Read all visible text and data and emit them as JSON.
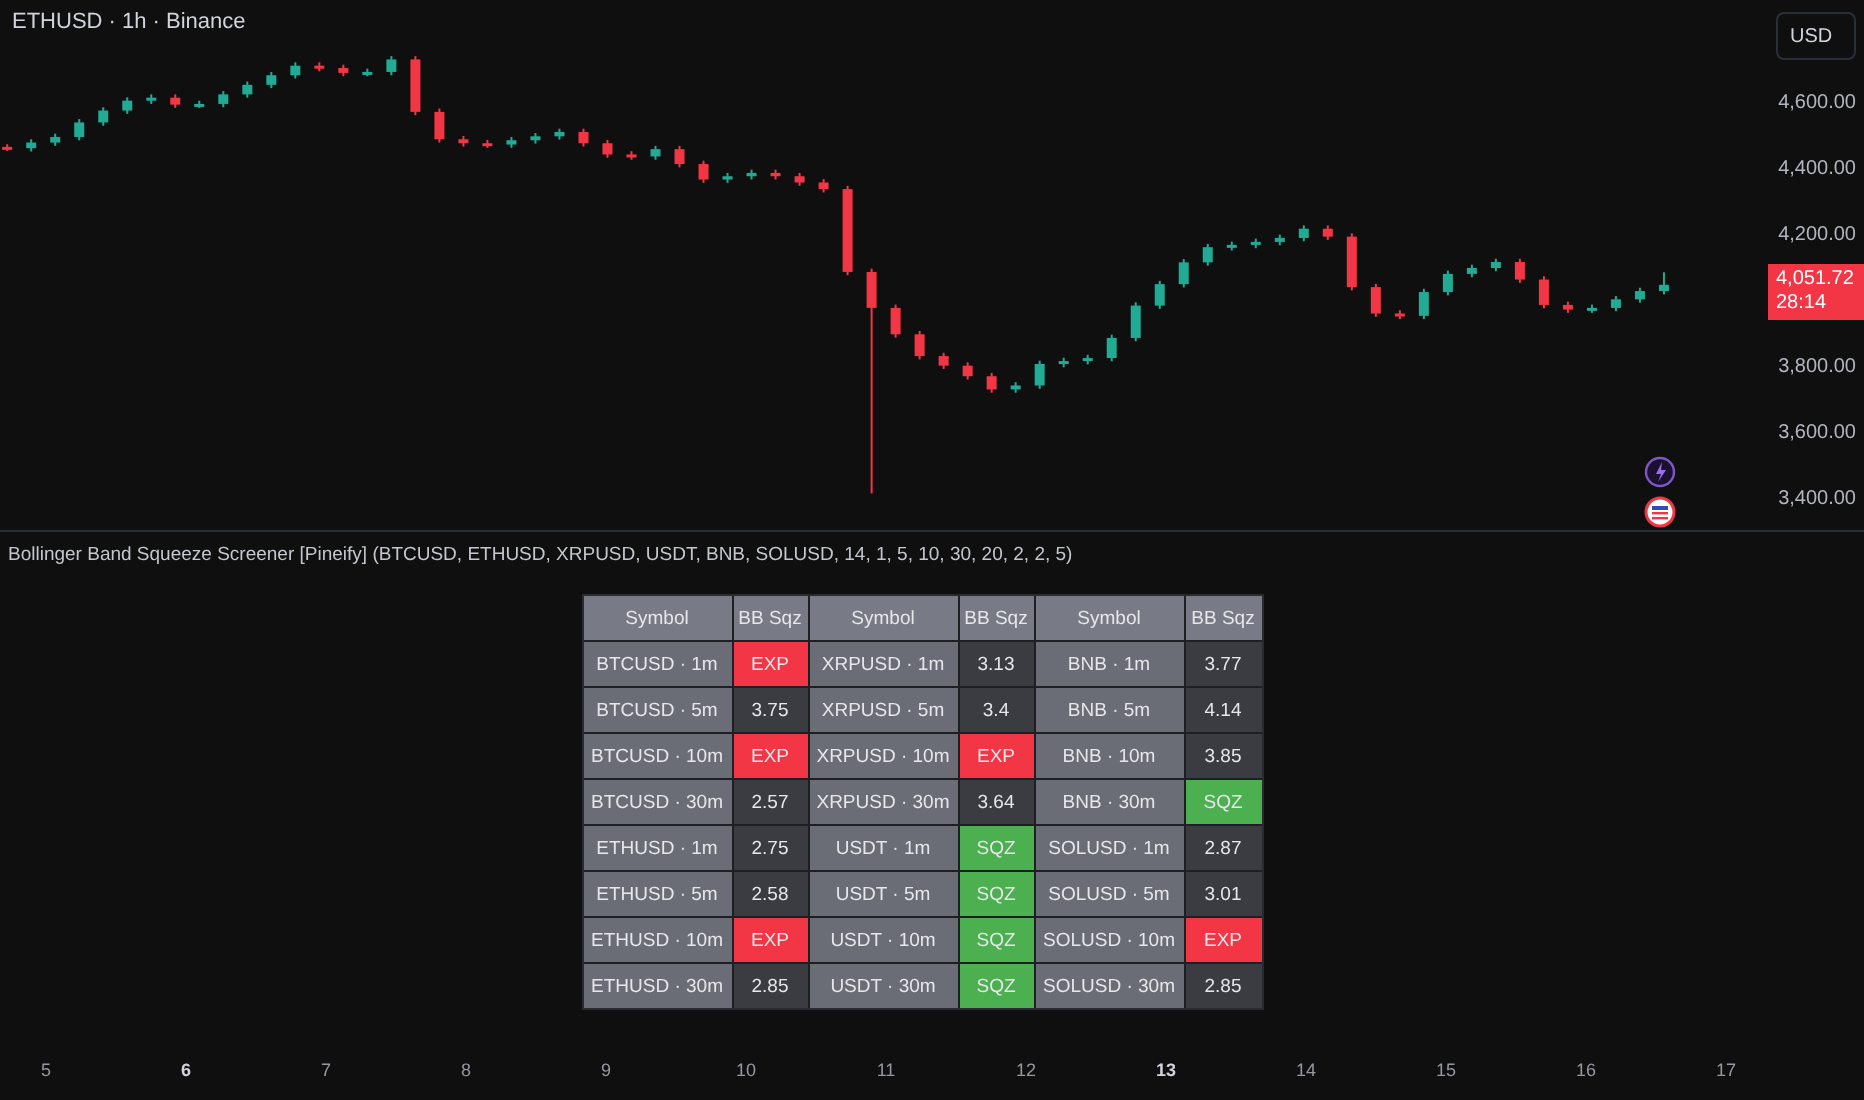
{
  "chart": {
    "title": "ETHUSD · 1h · Binance",
    "chart_data": {
      "type": "candlestick",
      "categories": [
        null,
        null,
        null,
        null,
        null,
        null,
        null,
        null,
        null,
        null,
        null,
        null,
        null,
        null,
        null,
        null,
        null,
        null,
        null,
        null,
        null,
        null,
        null,
        null,
        null,
        null,
        null,
        null,
        null,
        null,
        null,
        null,
        null,
        null,
        null,
        null,
        null,
        null,
        null,
        null,
        null,
        null,
        null,
        null,
        null,
        null,
        null,
        null,
        null,
        null,
        null,
        null,
        null,
        null,
        null,
        null,
        null,
        null,
        null,
        null,
        null,
        null,
        null,
        null,
        null,
        null,
        null,
        null,
        null,
        null
      ],
      "ylim": [
        3400,
        4600
      ],
      "yticks": [
        {
          "value": 4600,
          "label": "4,600.00"
        },
        {
          "value": 4400,
          "label": "4,400.00"
        },
        {
          "value": 4200,
          "label": "4,200.00"
        },
        {
          "value": 3800,
          "label": "3,800.00"
        },
        {
          "value": 3600,
          "label": "3,600.00"
        },
        {
          "value": 3400,
          "label": "3,400.00"
        }
      ],
      "ohlc": [
        [
          4470,
          4478,
          4458,
          4466
        ],
        [
          4466,
          4493,
          4456,
          4483
        ],
        [
          4483,
          4510,
          4473,
          4500
        ],
        [
          4500,
          4554,
          4490,
          4544
        ],
        [
          4544,
          4590,
          4534,
          4580
        ],
        [
          4580,
          4620,
          4570,
          4610
        ],
        [
          4610,
          4629,
          4600,
          4619
        ],
        [
          4619,
          4629,
          4588,
          4598
        ],
        [
          4598,
          4610,
          4588,
          4600
        ],
        [
          4600,
          4639,
          4590,
          4629
        ],
        [
          4629,
          4668,
          4619,
          4658
        ],
        [
          4658,
          4697,
          4648,
          4687
        ],
        [
          4687,
          4726,
          4677,
          4716
        ],
        [
          4716,
          4726,
          4699,
          4709
        ],
        [
          4709,
          4719,
          4684,
          4694
        ],
        [
          4694,
          4707,
          4684,
          4697
        ],
        [
          4697,
          4745,
          4687,
          4735
        ],
        [
          4735,
          4745,
          4566,
          4576
        ],
        [
          4576,
          4586,
          4483,
          4493
        ],
        [
          4493,
          4503,
          4471,
          4481
        ],
        [
          4481,
          4491,
          4467,
          4477
        ],
        [
          4477,
          4500,
          4467,
          4490
        ],
        [
          4490,
          4512,
          4480,
          4502
        ],
        [
          4502,
          4525,
          4492,
          4515
        ],
        [
          4515,
          4525,
          4471,
          4481
        ],
        [
          4481,
          4491,
          4437,
          4447
        ],
        [
          4447,
          4457,
          4431,
          4441
        ],
        [
          4441,
          4473,
          4431,
          4463
        ],
        [
          4463,
          4473,
          4408,
          4418
        ],
        [
          4418,
          4428,
          4361,
          4371
        ],
        [
          4371,
          4391,
          4361,
          4381
        ],
        [
          4381,
          4401,
          4371,
          4391
        ],
        [
          4391,
          4401,
          4371,
          4381
        ],
        [
          4381,
          4391,
          4352,
          4362
        ],
        [
          4362,
          4372,
          4332,
          4342
        ],
        [
          4342,
          4352,
          4081,
          4091
        ],
        [
          4091,
          4101,
          3420,
          3982
        ],
        [
          3982,
          3992,
          3892,
          3902
        ],
        [
          3902,
          3912,
          3826,
          3836
        ],
        [
          3836,
          3846,
          3797,
          3807
        ],
        [
          3807,
          3817,
          3765,
          3775
        ],
        [
          3775,
          3785,
          3725,
          3735
        ],
        [
          3735,
          3757,
          3725,
          3747
        ],
        [
          3747,
          3822,
          3737,
          3812
        ],
        [
          3812,
          3831,
          3802,
          3821
        ],
        [
          3821,
          3840,
          3811,
          3830
        ],
        [
          3830,
          3901,
          3820,
          3891
        ],
        [
          3891,
          3999,
          3881,
          3989
        ],
        [
          3989,
          4064,
          3979,
          4054
        ],
        [
          4054,
          4130,
          4044,
          4120
        ],
        [
          4120,
          4176,
          4110,
          4166
        ],
        [
          4166,
          4183,
          4156,
          4173
        ],
        [
          4173,
          4192,
          4163,
          4182
        ],
        [
          4182,
          4204,
          4172,
          4194
        ],
        [
          4194,
          4232,
          4184,
          4222
        ],
        [
          4222,
          4232,
          4188,
          4198
        ],
        [
          4198,
          4208,
          4035,
          4045
        ],
        [
          4045,
          4055,
          3955,
          3965
        ],
        [
          3965,
          3975,
          3948,
          3958
        ],
        [
          3958,
          4040,
          3948,
          4030
        ],
        [
          4030,
          4095,
          4020,
          4085
        ],
        [
          4085,
          4113,
          4075,
          4103
        ],
        [
          4103,
          4131,
          4093,
          4121
        ],
        [
          4121,
          4131,
          4058,
          4068
        ],
        [
          4068,
          4078,
          3981,
          3991
        ],
        [
          3991,
          4001,
          3967,
          3977
        ],
        [
          3977,
          3992,
          3967,
          3982
        ],
        [
          3982,
          4018,
          3972,
          4008
        ],
        [
          4008,
          4043,
          3998,
          4033
        ],
        [
          4033,
          4090,
          4023,
          4052
        ]
      ]
    }
  },
  "currency_button": "USD",
  "price_tag": {
    "last_price": "4,051.72",
    "countdown": "28:14"
  },
  "indicator": {
    "title": "Bollinger Band Squeeze Screener [Pineify] (BTCUSD, ETHUSD, XRPUSD, USDT, BNB, SOLUSD, 14, 1, 5, 10, 30, 20, 2, 2, 5)",
    "columns": [
      "Symbol",
      "BB Sqz",
      "Symbol",
      "BB Sqz",
      "Symbol",
      "BB Sqz"
    ],
    "rows": [
      [
        {
          "text": "BTCUSD · 1m",
          "kind": "symbol"
        },
        {
          "text": "EXP",
          "kind": "exp"
        },
        {
          "text": "XRPUSD · 1m",
          "kind": "symbol"
        },
        {
          "text": "3.13",
          "kind": "value"
        },
        {
          "text": "BNB · 1m",
          "kind": "symbol"
        },
        {
          "text": "3.77",
          "kind": "value"
        }
      ],
      [
        {
          "text": "BTCUSD · 5m",
          "kind": "symbol"
        },
        {
          "text": "3.75",
          "kind": "value"
        },
        {
          "text": "XRPUSD · 5m",
          "kind": "symbol"
        },
        {
          "text": "3.4",
          "kind": "value"
        },
        {
          "text": "BNB · 5m",
          "kind": "symbol"
        },
        {
          "text": "4.14",
          "kind": "value"
        }
      ],
      [
        {
          "text": "BTCUSD · 10m",
          "kind": "symbol"
        },
        {
          "text": "EXP",
          "kind": "exp"
        },
        {
          "text": "XRPUSD · 10m",
          "kind": "symbol"
        },
        {
          "text": "EXP",
          "kind": "exp"
        },
        {
          "text": "BNB · 10m",
          "kind": "symbol"
        },
        {
          "text": "3.85",
          "kind": "value"
        }
      ],
      [
        {
          "text": "BTCUSD · 30m",
          "kind": "symbol"
        },
        {
          "text": "2.57",
          "kind": "value"
        },
        {
          "text": "XRPUSD · 30m",
          "kind": "symbol"
        },
        {
          "text": "3.64",
          "kind": "value"
        },
        {
          "text": "BNB · 30m",
          "kind": "symbol"
        },
        {
          "text": "SQZ",
          "kind": "sqz"
        }
      ],
      [
        {
          "text": "ETHUSD · 1m",
          "kind": "symbol"
        },
        {
          "text": "2.75",
          "kind": "value"
        },
        {
          "text": "USDT · 1m",
          "kind": "symbol"
        },
        {
          "text": "SQZ",
          "kind": "sqz"
        },
        {
          "text": "SOLUSD · 1m",
          "kind": "symbol"
        },
        {
          "text": "2.87",
          "kind": "value"
        }
      ],
      [
        {
          "text": "ETHUSD · 5m",
          "kind": "symbol"
        },
        {
          "text": "2.58",
          "kind": "value"
        },
        {
          "text": "USDT · 5m",
          "kind": "symbol"
        },
        {
          "text": "SQZ",
          "kind": "sqz"
        },
        {
          "text": "SOLUSD · 5m",
          "kind": "symbol"
        },
        {
          "text": "3.01",
          "kind": "value"
        }
      ],
      [
        {
          "text": "ETHUSD · 10m",
          "kind": "symbol"
        },
        {
          "text": "EXP",
          "kind": "exp"
        },
        {
          "text": "USDT · 10m",
          "kind": "symbol"
        },
        {
          "text": "SQZ",
          "kind": "sqz"
        },
        {
          "text": "SOLUSD · 10m",
          "kind": "symbol"
        },
        {
          "text": "EXP",
          "kind": "exp"
        }
      ],
      [
        {
          "text": "ETHUSD · 30m",
          "kind": "symbol"
        },
        {
          "text": "2.85",
          "kind": "value"
        },
        {
          "text": "USDT · 30m",
          "kind": "symbol"
        },
        {
          "text": "SQZ",
          "kind": "sqz"
        },
        {
          "text": "SOLUSD · 30m",
          "kind": "symbol"
        },
        {
          "text": "2.85",
          "kind": "value"
        }
      ]
    ]
  },
  "time_axis": [
    {
      "label": "5",
      "major": false
    },
    {
      "label": "6",
      "major": true
    },
    {
      "label": "7",
      "major": false
    },
    {
      "label": "8",
      "major": false
    },
    {
      "label": "9",
      "major": false
    },
    {
      "label": "10",
      "major": false
    },
    {
      "label": "11",
      "major": false
    },
    {
      "label": "12",
      "major": false
    },
    {
      "label": "13",
      "major": true
    },
    {
      "label": "14",
      "major": false
    },
    {
      "label": "15",
      "major": false
    },
    {
      "label": "16",
      "major": false
    },
    {
      "label": "17",
      "major": false
    }
  ]
}
